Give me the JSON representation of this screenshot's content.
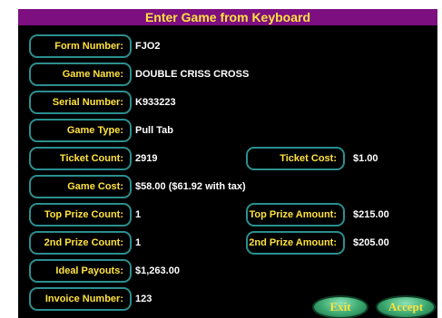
{
  "window": {
    "title": "Enter Game from Keyboard"
  },
  "fields": [
    {
      "label": "Form Number:",
      "value": "FJO2"
    },
    {
      "label": "Game Name:",
      "value": "DOUBLE CRISS CROSS"
    },
    {
      "label": "Serial Number:",
      "value": "K933223"
    },
    {
      "label": "Game Type:",
      "value": "Pull Tab"
    },
    {
      "label": "Ticket Count:",
      "value": "2919"
    },
    {
      "label": "Game Cost:",
      "value": "$58.00 ($61.92 with tax)"
    },
    {
      "label": "Top Prize Count:",
      "value": "1"
    },
    {
      "label": "2nd Prize Count:",
      "value": "1"
    },
    {
      "label": "Ideal Payouts:",
      "value": "$1,263.00"
    },
    {
      "label": "Invoice Number:",
      "value": "123"
    }
  ],
  "right_fields": [
    {
      "label": "Ticket Cost:",
      "value": "$1.00"
    },
    {
      "label": "Top Prize Amount:",
      "value": "$215.00"
    },
    {
      "label": "2nd Prize Amount:",
      "value": "$205.00"
    }
  ],
  "buttons": {
    "exit": "Exit",
    "accept": "Accept"
  },
  "colors": {
    "title_bg": "#7d0f80",
    "label_text": "#ffe23f",
    "border": "#2b8f8f",
    "button": "#3aa76e"
  }
}
